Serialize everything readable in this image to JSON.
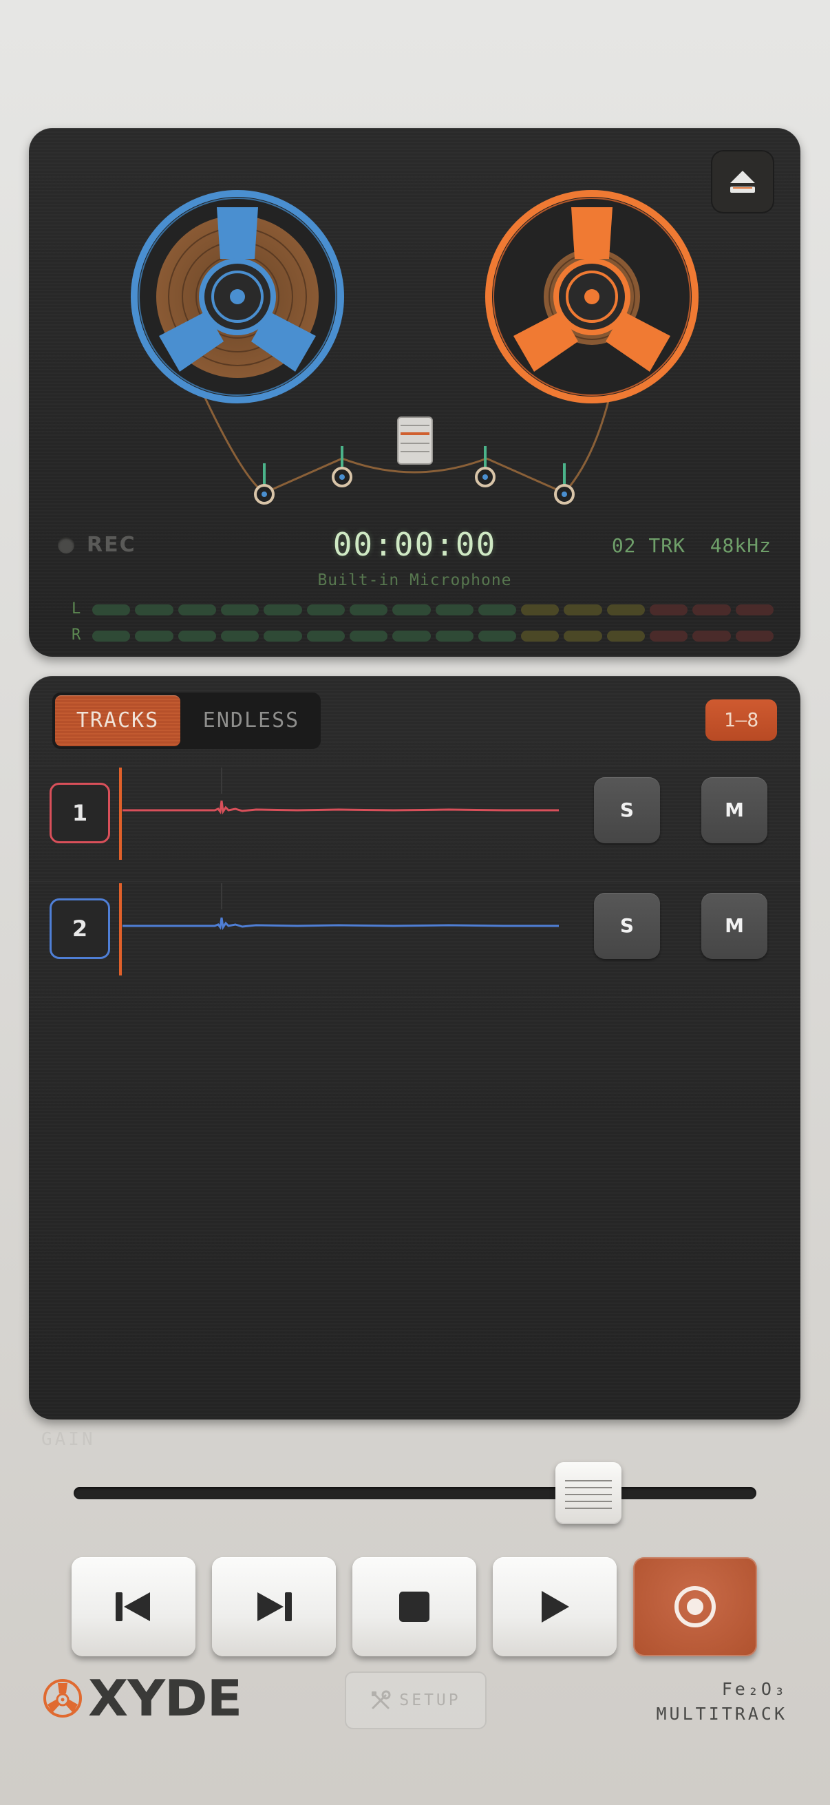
{
  "deck": {
    "eject_icon": "eject-icon",
    "rec_label": "REC",
    "timecode": "00:00:00",
    "track_count": "02 TRK",
    "sample_rate": "48kHz",
    "input_source": "Built-in Microphone",
    "meter_left_label": "L",
    "meter_right_label": "R",
    "colors": {
      "left_reel": "#4a8fd0",
      "right_reel": "#f07a33",
      "meter_green": "#2f4a36",
      "meter_yellow": "#4b4826",
      "meter_red": "#4a2b2a"
    }
  },
  "tracks_panel": {
    "mode_tracks": "TRACKS",
    "mode_endless": "ENDLESS",
    "active_mode": "TRACKS",
    "range": "1–8",
    "tracks": [
      {
        "number": "1",
        "color": "#d9505a",
        "solo": "S",
        "mute": "M"
      },
      {
        "number": "2",
        "color": "#4f7fd6",
        "solo": "S",
        "mute": "M"
      }
    ]
  },
  "gain": {
    "label": "GAIN",
    "level": 0.8
  },
  "transport": {
    "buttons": [
      "skip-back",
      "skip-forward",
      "stop",
      "play",
      "record"
    ]
  },
  "footer": {
    "brand": "XYDE",
    "setup_label": "SETUP",
    "model_line1": "Fe₂O₃",
    "model_line2": "MULTITRACK",
    "accent": "#e06a30"
  }
}
